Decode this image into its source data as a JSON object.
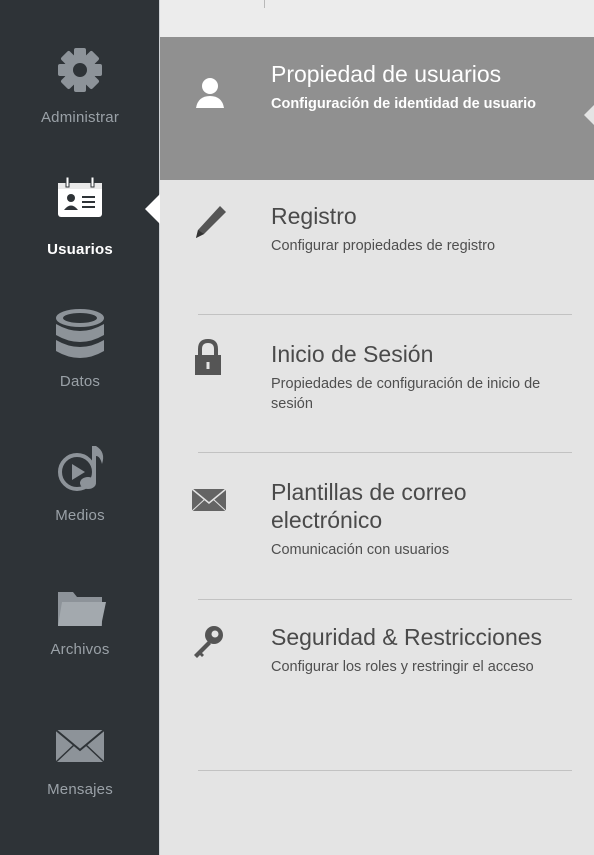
{
  "colors": {
    "sidebar_bg": "#2e3337",
    "sidebar_label": "#9aa1a7",
    "sidebar_label_active": "#ffffff",
    "panel_bg": "#e4e4e4",
    "selected_bg": "#909090"
  },
  "sidebar": {
    "items": [
      {
        "label": "Administrar",
        "icon": "gear-icon",
        "active": false
      },
      {
        "label": "Usuarios",
        "icon": "user-card-icon",
        "active": true
      },
      {
        "label": "Datos",
        "icon": "database-icon",
        "active": false
      },
      {
        "label": "Medios",
        "icon": "media-icon",
        "active": false
      },
      {
        "label": "Archivos",
        "icon": "folder-icon",
        "active": false
      },
      {
        "label": "Mensajes",
        "icon": "envelope-icon",
        "active": false
      }
    ]
  },
  "panel": {
    "items": [
      {
        "title": "Propiedad de usuarios",
        "description": "Configuración de identidad de usuario",
        "icon": "user-icon",
        "selected": true
      },
      {
        "title": "Registro",
        "description": "Configurar propiedades de registro",
        "icon": "pen-icon",
        "selected": false
      },
      {
        "title": "Inicio de Sesión",
        "description": "Propiedades de configuración de inicio de sesión",
        "icon": "lock-icon",
        "selected": false
      },
      {
        "title": "Plantillas de correo electrónico",
        "description": "Comunicación con usuarios",
        "icon": "envelope-icon",
        "selected": false
      },
      {
        "title": "Seguridad & Restricciones",
        "description": "Configurar los roles y restringir el acceso",
        "icon": "key-icon",
        "selected": false
      }
    ]
  }
}
